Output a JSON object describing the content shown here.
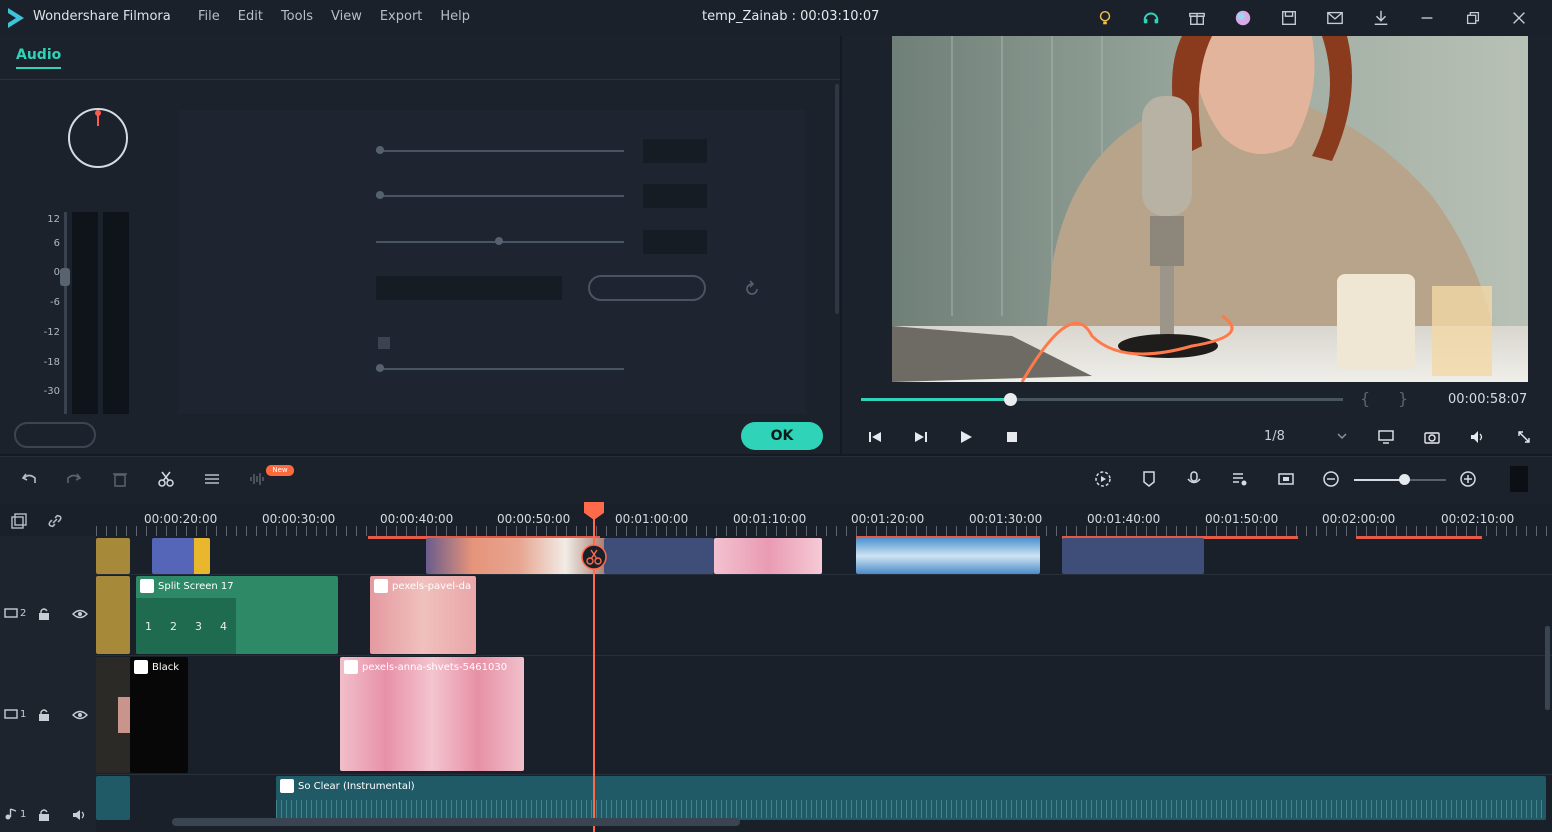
{
  "app": {
    "brand": "Wondershare Filmora",
    "title": "temp_Zainab : 00:03:10:07",
    "menu": [
      "File",
      "Edit",
      "Tools",
      "View",
      "Export",
      "Help"
    ],
    "title_icons": [
      "bulb-icon",
      "headset-icon",
      "gift-icon",
      "avatar-icon",
      "save-icon",
      "mail-icon",
      "download-icon",
      "minimize-icon",
      "restore-icon",
      "close-icon"
    ]
  },
  "audio_panel": {
    "tab": "Audio",
    "meter_scale": [
      "12",
      "6",
      "0",
      "-6",
      "-12",
      "-18",
      "-30"
    ],
    "ok_label": "OK"
  },
  "preview": {
    "time": "00:00:58:07",
    "quality": "1/8",
    "mark_in": "{",
    "mark_out": "}",
    "progress": 0.31
  },
  "toolbar": {
    "new_badge": "New"
  },
  "timeline": {
    "ruler": [
      "00:00:20:00",
      "00:00:30:00",
      "00:00:40:00",
      "00:00:50:00",
      "00:01:00:00",
      "00:01:10:00",
      "00:01:20:00",
      "00:01:30:00",
      "00:01:40:00",
      "00:01:50:00",
      "00:02:00:00",
      "00:02:10:00"
    ],
    "tracks": [
      {
        "label": "2",
        "type": "video"
      },
      {
        "label": "1",
        "type": "video"
      },
      {
        "label": "1",
        "type": "audio"
      }
    ],
    "clips": {
      "split_screen": "Split Screen 17",
      "split_numbers": [
        "1",
        "2",
        "3",
        "4"
      ],
      "pexels_a": "pexels-pavel-da",
      "black": "Black",
      "pexels_b": "pexels-anna-shvets-5461030",
      "music": "So Clear (Instrumental)"
    }
  }
}
